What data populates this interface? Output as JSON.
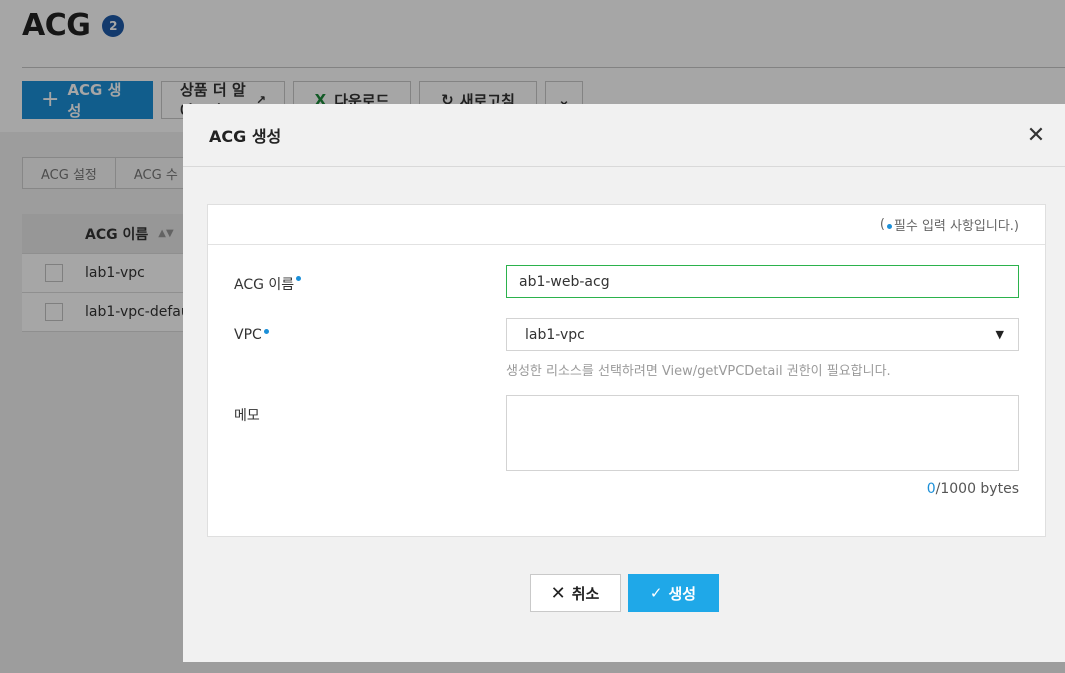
{
  "header": {
    "title": "ACG",
    "count": "2"
  },
  "toolbar": {
    "create_label": "ACG 생성",
    "more_label": "상품 더 알아보기",
    "download_label": "다운로드",
    "refresh_label": "새로고침"
  },
  "sub_tabs": [
    "ACG 설정",
    "ACG 수"
  ],
  "table": {
    "headers": [
      "ACG 이름"
    ],
    "rows": [
      {
        "name": "lab1-vpc"
      },
      {
        "name": "lab1-vpc-defau"
      }
    ]
  },
  "modal": {
    "title": "ACG 생성",
    "required_note_prefix": "(",
    "required_note": "필수 입력 사항입니다.)",
    "fields": {
      "name_label": "ACG 이름",
      "name_value": "ab1-web-acg",
      "vpc_label": "VPC",
      "vpc_value": "lab1-vpc",
      "vpc_hint": "생성한 리소스를 선택하려면 View/getVPCDetail 권한이 필요합니다.",
      "memo_label": "메모",
      "memo_value": "",
      "byte_current": "0",
      "byte_total": "/1000 bytes"
    },
    "buttons": {
      "cancel": "취소",
      "create": "생성"
    }
  },
  "colors": {
    "primary": "#1b8fd8",
    "create_button": "#1fa8e8",
    "input_focus": "#2bb24c",
    "badge": "#1e5aa8"
  },
  "icons": [
    "plus-icon",
    "external-link-icon",
    "excel-icon",
    "refresh-icon",
    "chevron-down-icon",
    "sort-icon",
    "close-icon",
    "required-dot-icon",
    "dropdown-caret-icon",
    "check-icon"
  ]
}
